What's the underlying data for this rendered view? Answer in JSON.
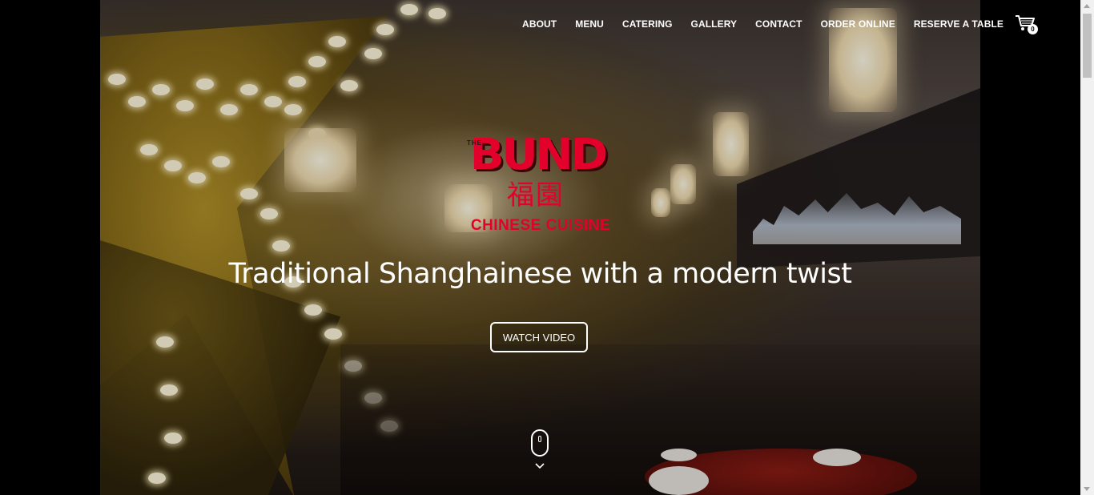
{
  "nav": {
    "items": [
      {
        "label": "ABOUT"
      },
      {
        "label": "MENU"
      },
      {
        "label": "CATERING"
      },
      {
        "label": "GALLERY"
      },
      {
        "label": "CONTACT"
      },
      {
        "label": "ORDER ONLINE"
      },
      {
        "label": "RESERVE A TABLE"
      }
    ],
    "cart_count": "0",
    "cart_icon": "shopping-cart-icon"
  },
  "logo": {
    "the": "THE",
    "word": "BUND",
    "hanzi": "福園",
    "subtitle": "CHINESE CUISINE"
  },
  "hero": {
    "tagline": "Traditional Shanghainese with a modern twist",
    "button_label": "WATCH VIDEO",
    "scroll_icon": "mouse-scroll-icon",
    "scroll_arrow_icon": "chevron-down-icon"
  },
  "colors": {
    "brand_red": "#e3002b",
    "nav_text": "#ffffff",
    "page_background": "#000000"
  }
}
